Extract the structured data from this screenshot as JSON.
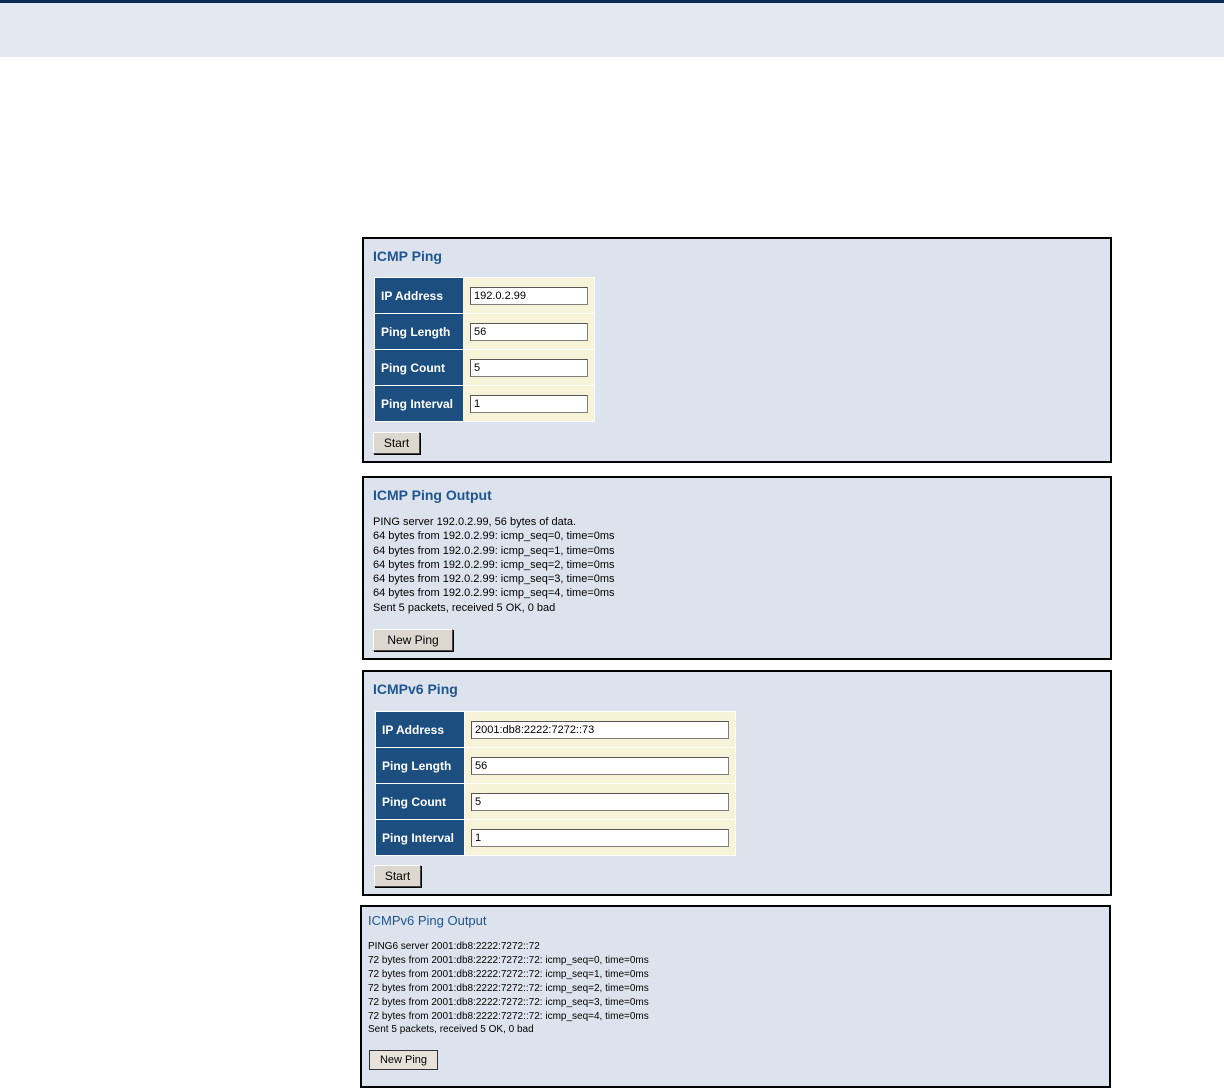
{
  "icmp_ping": {
    "title": "ICMP Ping",
    "fields": [
      {
        "label": "IP Address",
        "value": "192.0.2.99"
      },
      {
        "label": "Ping Length",
        "value": "56"
      },
      {
        "label": "Ping Count",
        "value": "5"
      },
      {
        "label": "Ping Interval",
        "value": "1"
      }
    ],
    "start_label": "Start"
  },
  "icmp_output": {
    "title": "ICMP Ping Output",
    "lines": [
      "PING server 192.0.2.99, 56 bytes of data.",
      "64 bytes from 192.0.2.99: icmp_seq=0, time=0ms",
      "64 bytes from 192.0.2.99: icmp_seq=1, time=0ms",
      "64 bytes from 192.0.2.99: icmp_seq=2, time=0ms",
      "64 bytes from 192.0.2.99: icmp_seq=3, time=0ms",
      "64 bytes from 192.0.2.99: icmp_seq=4, time=0ms",
      "Sent 5 packets, received 5 OK, 0 bad"
    ],
    "new_ping_label": "New Ping"
  },
  "icmpv6_ping": {
    "title": "ICMPv6 Ping",
    "fields": [
      {
        "label": "IP Address",
        "value": "2001:db8:2222:7272::73"
      },
      {
        "label": "Ping Length",
        "value": "56"
      },
      {
        "label": "Ping Count",
        "value": "5"
      },
      {
        "label": "Ping Interval",
        "value": "1"
      }
    ],
    "start_label": "Start"
  },
  "icmpv6_output": {
    "title": "ICMPv6 Ping Output",
    "lines": [
      "PING6 server 2001:db8:2222:7272::72",
      "72 bytes from 2001:db8:2222:7272::72: icmp_seq=0, time=0ms",
      "72 bytes from 2001:db8:2222:7272::72: icmp_seq=1, time=0ms",
      "72 bytes from 2001:db8:2222:7272::72: icmp_seq=2, time=0ms",
      "72 bytes from 2001:db8:2222:7272::72: icmp_seq=3, time=0ms",
      "72 bytes from 2001:db8:2222:7272::72: icmp_seq=4, time=0ms",
      "Sent 5 packets, received 5 OK, 0 bad"
    ],
    "new_ping_label": "New Ping"
  }
}
